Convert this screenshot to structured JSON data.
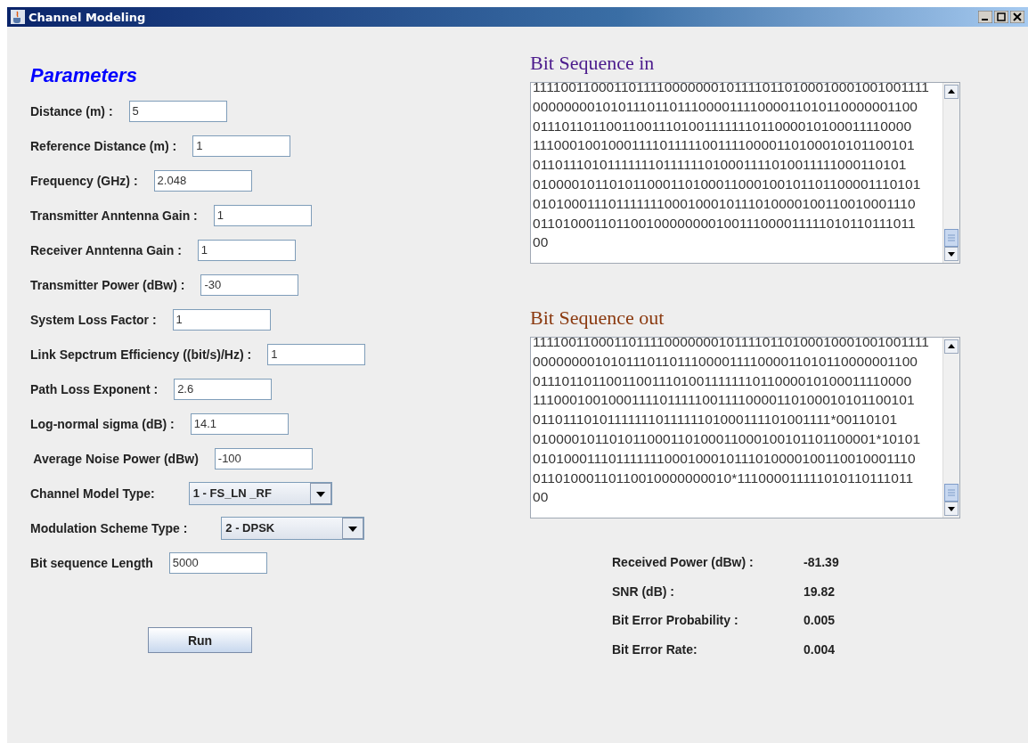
{
  "window": {
    "title": "Channel Modeling"
  },
  "parameters": {
    "title": "Parameters",
    "fields": [
      {
        "kind": "text",
        "label": "Distance (m) :",
        "value": "5"
      },
      {
        "kind": "text",
        "label": "Reference Distance (m) :",
        "value": "1"
      },
      {
        "kind": "text",
        "label": "Frequency (GHz) :",
        "value": "2.048"
      },
      {
        "kind": "text",
        "label": "Transmitter Anntenna Gain :",
        "value": "1"
      },
      {
        "kind": "text",
        "label": "Receiver Anntenna Gain :",
        "value": "1"
      },
      {
        "kind": "text",
        "label": "Transmitter Power (dBw) :",
        "value": "-30"
      },
      {
        "kind": "text",
        "label": "System Loss Factor :",
        "value": "1"
      },
      {
        "kind": "text",
        "label": "Link Sepctrum Efficiency ((bit/s)/Hz) :",
        "value": "1"
      },
      {
        "kind": "text",
        "label": "Path Loss Exponent :",
        "value": "2.6"
      },
      {
        "kind": "text",
        "label": "Log-normal sigma (dB) :",
        "value": "14.1"
      },
      {
        "kind": "text",
        "label": " Average Noise Power (dBw)",
        "value": "-100"
      },
      {
        "kind": "select",
        "label": "Channel Model Type:",
        "value": "1 - FS_LN _RF"
      },
      {
        "kind": "select",
        "label": "Modulation Scheme Type :",
        "value": "2 - DPSK"
      },
      {
        "kind": "text",
        "label": "Bit sequence Length",
        "value": "5000"
      }
    ]
  },
  "run_button": "Run",
  "bit_sequence_in": {
    "title": "Bit Sequence in",
    "lines": [
      "11110011000110111100000001011110110100010001001001111",
      "000000001010111011011100001111000011010110000001100",
      "011101101100110011101001111111011000010100011110000",
      "111000100100011110111110011110000110100010101100101",
      "011011101011111110111111010001111010011111000110101",
      "010000101101011000110100011000100101101100001110101",
      "010100011101111111000100010111010000100110010001110",
      "011010001101100100000000100111000011111010110111011",
      "00"
    ]
  },
  "bit_sequence_out": {
    "title": "Bit Sequence out",
    "lines": [
      "11110011000110111100000001011110110100010001001001111",
      "000000001010111011011100001111000011010110000001100",
      "011101101100110011101001111111011000010100011110000",
      "111000100100011110111110011110000110100010101100101",
      "01101110101111111011111101000111101001111*00110101",
      "010000101101011000110100011000100101101100001*10101",
      "010100011101111111000100010111010000100110010001110",
      "01101000110110010000000010*111000011111010110111011",
      "00"
    ]
  },
  "results": [
    {
      "label": "Received Power (dBw) :",
      "value": "-81.39"
    },
    {
      "label": "SNR (dB) :",
      "value": "19.82"
    },
    {
      "label": "Bit Error Probability :",
      "value": "0.005"
    },
    {
      "label": "Bit Error Rate:",
      "value": "0.004"
    }
  ]
}
